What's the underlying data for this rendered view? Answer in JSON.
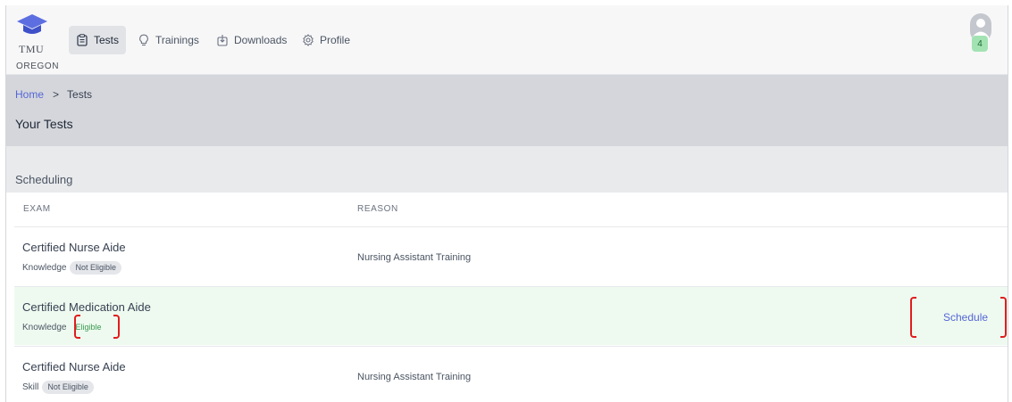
{
  "nav": {
    "logo_top": "TMU",
    "logo_bottom": "OREGON",
    "items": [
      {
        "label": "Tests",
        "icon": "clipboard-icon",
        "active": true
      },
      {
        "label": "Trainings",
        "icon": "lightbulb-icon",
        "active": false
      },
      {
        "label": "Downloads",
        "icon": "download-icon",
        "active": false
      },
      {
        "label": "Profile",
        "icon": "gear-icon",
        "active": false
      }
    ],
    "notification_count": "4"
  },
  "breadcrumb": {
    "home": "Home",
    "separator": ">",
    "current": "Tests"
  },
  "page_title": "Your Tests",
  "section_title": "Scheduling",
  "table": {
    "headers": [
      "EXAM",
      "REASON"
    ],
    "rows": [
      {
        "exam": "Certified Nurse Aide",
        "type": "Knowledge",
        "status": "Not Eligible",
        "reason": "Nursing Assistant Training",
        "action": ""
      },
      {
        "exam": "Certified Medication Aide",
        "type": "Knowledge",
        "status": "Eligible",
        "reason": "",
        "action": "Schedule"
      },
      {
        "exam": "Certified Nurse Aide",
        "type": "Skill",
        "status": "Not Eligible",
        "reason": "Nursing Assistant Training",
        "action": ""
      }
    ]
  },
  "colors": {
    "accent": "#5566d6",
    "eligible_row": "#eefaf0",
    "eligible_text": "#3a9a4f",
    "highlight": "#e11d1d"
  }
}
